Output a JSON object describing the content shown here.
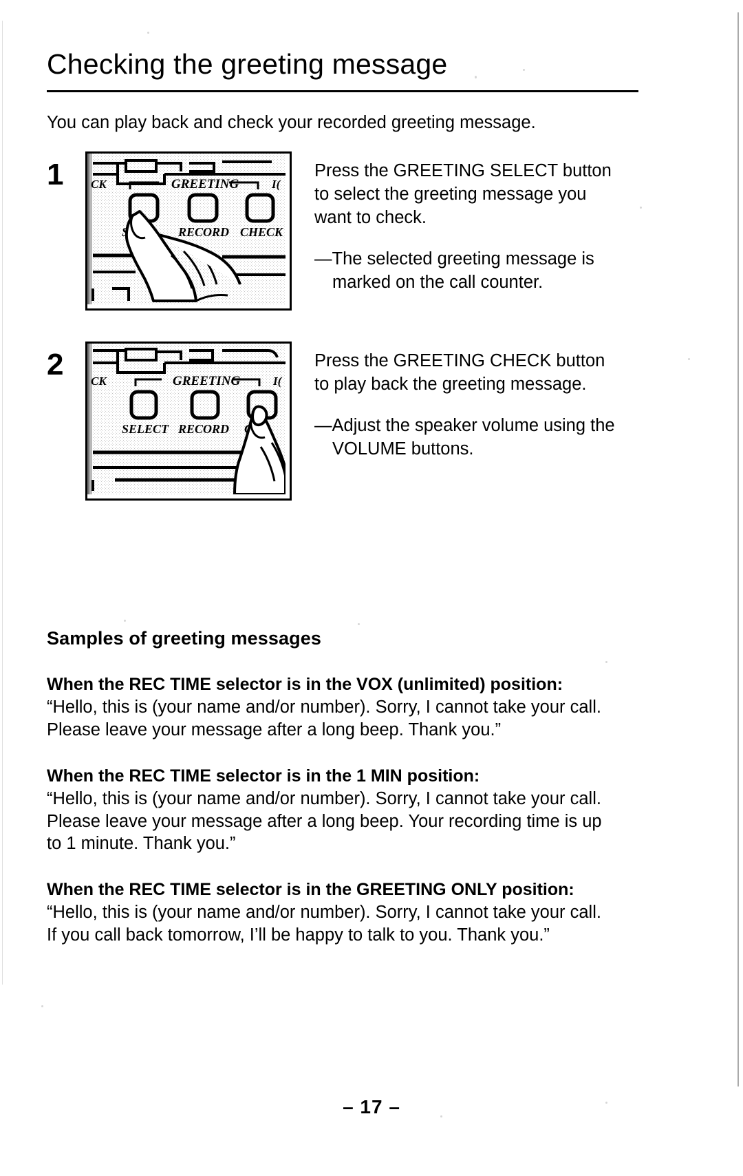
{
  "document": {
    "title": "Checking the greeting message",
    "intro": "You can play back and check your recorded greeting message.",
    "page_number": "– 17 –"
  },
  "steps": [
    {
      "number": "1",
      "instruction_lines": [
        "Press the GREETING SELECT button",
        "to select the greeting message you",
        "want to check."
      ],
      "note_lines": [
        "—The selected greeting message is",
        "marked on the call counter."
      ],
      "illustration": {
        "panel_label": "answering-machine-control-panel",
        "group_label": "GREETING",
        "left_partial_label": "CK",
        "right_partial_label": "I(",
        "buttons": [
          {
            "label": "SELE",
            "full_label": "SELECT",
            "pressed": true
          },
          {
            "label": "RECORD",
            "full_label": "RECORD",
            "pressed": false
          },
          {
            "label": "CHECK",
            "full_label": "CHECK",
            "pressed": false
          }
        ]
      }
    },
    {
      "number": "2",
      "instruction_lines": [
        "Press the GREETING CHECK button",
        "to play back the greeting message."
      ],
      "note_lines": [
        "—Adjust the speaker volume using the",
        "VOLUME buttons."
      ],
      "illustration": {
        "panel_label": "answering-machine-control-panel",
        "group_label": "GREETING",
        "left_partial_label": "CK",
        "right_partial_label": "I(",
        "buttons": [
          {
            "label": "SELECT",
            "full_label": "SELECT",
            "pressed": false
          },
          {
            "label": "RECORD",
            "full_label": "RECORD",
            "pressed": false
          },
          {
            "label": "CHE",
            "full_label": "CHECK",
            "pressed": true
          }
        ]
      }
    }
  ],
  "samples": {
    "heading": "Samples of greeting messages",
    "blocks": [
      {
        "head": "When the REC TIME selector is in the VOX (unlimited) position:",
        "lines": [
          "“Hello, this is (your name and/or number). Sorry, I cannot take your call.",
          "Please leave your message after a long beep. Thank you.”"
        ]
      },
      {
        "head": "When the REC TIME selector is in the 1 MIN position:",
        "lines": [
          "“Hello, this is (your name and/or number). Sorry, I cannot take your call.",
          "Please leave your message after a long beep. Your recording time is up",
          "to 1 minute. Thank you.”"
        ]
      },
      {
        "head": "When the REC TIME selector is in the GREETING ONLY position:",
        "lines": [
          "“Hello, this is (your name and/or number). Sorry, I cannot take your call.",
          "If you call back tomorrow, I’ll be happy to talk to you. Thank you.”"
        ]
      }
    ]
  },
  "colors": {
    "ink": "#000000",
    "paper": "#ffffff",
    "panel_stipple": "#d8d8d8"
  }
}
